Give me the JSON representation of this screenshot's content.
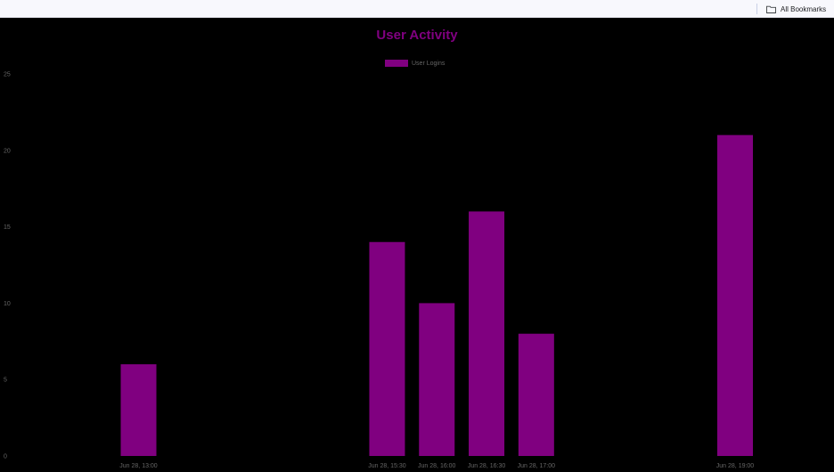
{
  "browser": {
    "bookmarks_label": "All Bookmarks",
    "folder_icon": "folder-icon"
  },
  "colors": {
    "background": "#000000",
    "accent": "#800080",
    "tick_text": "#666666",
    "bookmarks_bar": "#f8f8fd"
  },
  "chart_data": {
    "type": "bar",
    "title": "User Activity",
    "xlabel": "",
    "ylabel": "",
    "x_axis": "time",
    "x_unit": "30-minute intervals",
    "x_range": [
      "Jun 28, 13:00",
      "Jun 28, 19:00"
    ],
    "x_ticks": [
      "Jun 28, 13:00",
      "Jun 28, 15:30",
      "Jun 28, 16:00",
      "Jun 28, 16:30",
      "Jun 28, 17:00",
      "Jun 28, 19:00"
    ],
    "ylim": [
      0,
      25
    ],
    "y_ticks": [
      "0",
      "5",
      "10",
      "15",
      "20",
      "25"
    ],
    "grid": false,
    "legend_position": "top-center",
    "series": [
      {
        "name": "User Logins",
        "color": "#800080",
        "points": [
          {
            "x": "Jun 28, 13:00",
            "y": 6
          },
          {
            "x": "Jun 28, 15:30",
            "y": 14
          },
          {
            "x": "Jun 28, 16:00",
            "y": 10
          },
          {
            "x": "Jun 28, 16:30",
            "y": 16
          },
          {
            "x": "Jun 28, 17:00",
            "y": 8
          },
          {
            "x": "Jun 28, 19:00",
            "y": 21
          }
        ]
      }
    ]
  }
}
